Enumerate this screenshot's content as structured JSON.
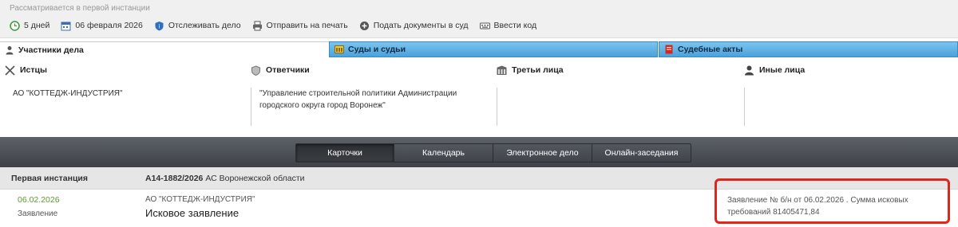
{
  "status": "Рассматривается в первой инстанции",
  "toolbar": {
    "days": "5 дней",
    "date": "06 февраля 2026",
    "track": "Отслеживать дело",
    "print": "Отправить на печать",
    "submit": "Подать документы в суд",
    "code": "Ввести код"
  },
  "tabs": {
    "participants": "Участники дела",
    "courts": "Суды и судьи",
    "acts": "Судебные акты"
  },
  "participants": {
    "plaintiffs": {
      "label": "Истцы",
      "value": "АО \"КОТТЕДЖ-ИНДУСТРИЯ\""
    },
    "defendants": {
      "label": "Ответчики",
      "value": "\"Управление строительной политики Администрации городского округа город Воронеж\""
    },
    "third": {
      "label": "Третьи лица",
      "value": ""
    },
    "other": {
      "label": "Иные лица",
      "value": ""
    }
  },
  "views": [
    "Карточки",
    "Календарь",
    "Электронное дело",
    "Онлайн-заседания"
  ],
  "case": {
    "instance": "Первая инстанция",
    "number": "А14-1882/2026",
    "court": "АС Воронежской области"
  },
  "document": {
    "date": "06.02.2026",
    "type": "Заявление",
    "party": "АО \"КОТТЕДЖ-ИНДУСТРИЯ\"",
    "title": "Исковое заявление",
    "info": "Заявление № б/н от 06.02.2026 . Сумма исковых требований 81405471,84"
  },
  "colors": {
    "accent_blue": "#4aa2db",
    "date_green": "#5e9a2e",
    "highlight_red": "#e0251b"
  }
}
